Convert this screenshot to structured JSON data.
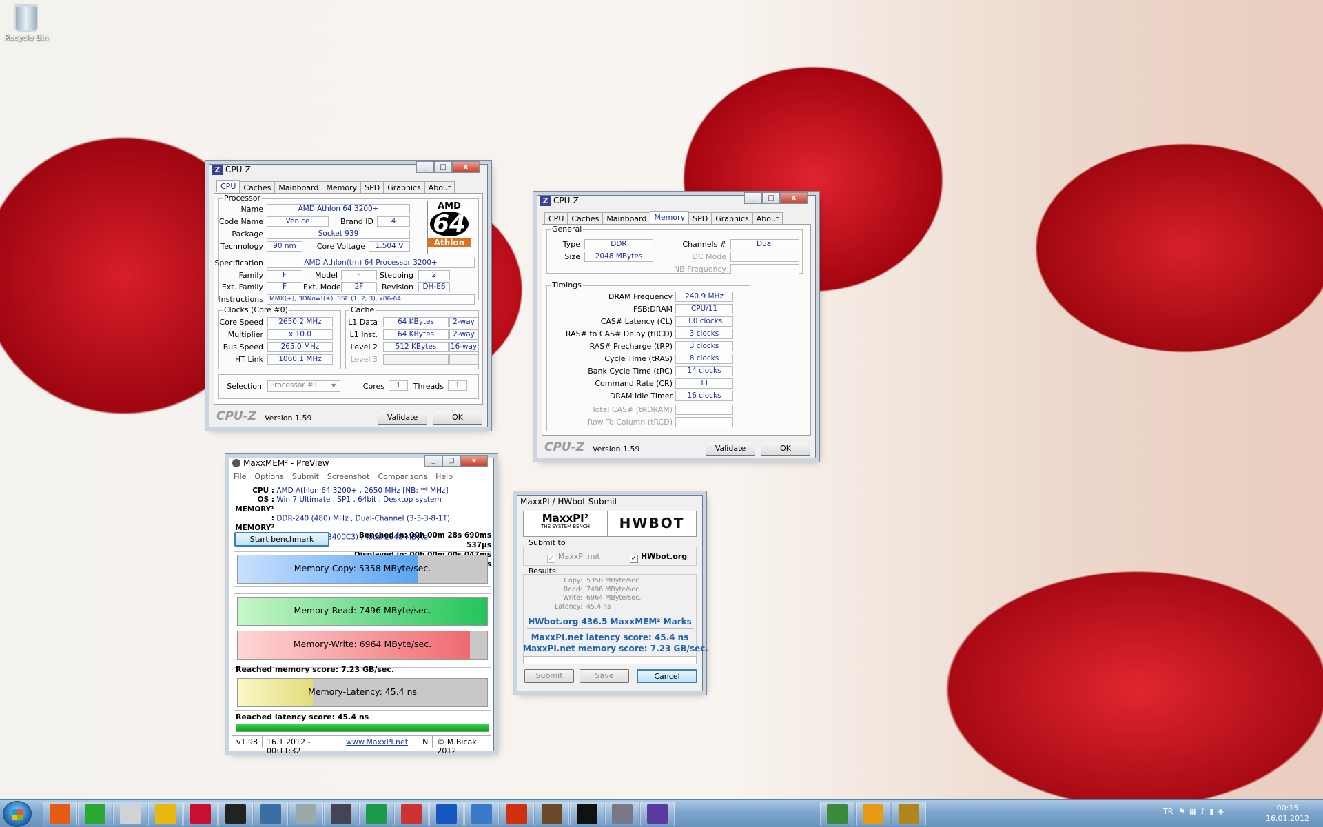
{
  "desktop": {
    "recycle_bin": "Recycle Bin"
  },
  "cpuz1": {
    "title": "CPU-Z",
    "tabs": [
      "CPU",
      "Caches",
      "Mainboard",
      "Memory",
      "SPD",
      "Graphics",
      "About"
    ],
    "processor_group": "Processor",
    "name_l": "Name",
    "name": "AMD Athlon 64 3200+",
    "codename_l": "Code Name",
    "codename": "Venice",
    "brandid_l": "Brand ID",
    "brandid": "4",
    "package_l": "Package",
    "package": "Socket 939",
    "tech_l": "Technology",
    "tech": "90 nm",
    "corev_l": "Core Voltage",
    "corev": "1.504 V",
    "spec_l": "Specification",
    "spec": "AMD Athlon(tm) 64 Processor 3200+",
    "family_l": "Family",
    "family": "F",
    "model_l": "Model",
    "model": "F",
    "stepping_l": "Stepping",
    "stepping": "2",
    "extfamily_l": "Ext. Family",
    "extfamily": "F",
    "extmodel_l": "Ext. Model",
    "extmodel": "2F",
    "revision_l": "Revision",
    "revision": "DH-E6",
    "instr_l": "Instructions",
    "instr": "MMX(+), 3DNow!(+), SSE (1, 2, 3), x86-64",
    "logo_top": "AMD",
    "logo_num": "64",
    "logo_bottom": "Athlon",
    "clocks_group": "Clocks (Core #0)",
    "corespeed_l": "Core Speed",
    "corespeed": "2650.2 MHz",
    "mult_l": "Multiplier",
    "mult": "x 10.0",
    "bus_l": "Bus Speed",
    "bus": "265.0 MHz",
    "ht_l": "HT Link",
    "ht": "1060.1 MHz",
    "cache_group": "Cache",
    "l1d_l": "L1 Data",
    "l1d": "64 KBytes",
    "l1d_w": "2-way",
    "l1i_l": "L1 Inst.",
    "l1i": "64 KBytes",
    "l1i_w": "2-way",
    "l2_l": "Level 2",
    "l2": "512 KBytes",
    "l2_w": "16-way",
    "l3_l": "Level 3",
    "selection_l": "Selection",
    "selection": "Processor #1",
    "cores_l": "Cores",
    "cores": "1",
    "threads_l": "Threads",
    "threads": "1",
    "brand": "CPU-Z",
    "version": "Version 1.59",
    "validate": "Validate",
    "ok": "OK"
  },
  "cpuz2": {
    "title": "CPU-Z",
    "tabs": [
      "CPU",
      "Caches",
      "Mainboard",
      "Memory",
      "SPD",
      "Graphics",
      "About"
    ],
    "general_group": "General",
    "type_l": "Type",
    "type": "DDR",
    "size_l": "Size",
    "size": "2048 MBytes",
    "channels_l": "Channels #",
    "channels": "Dual",
    "dcmode_l": "DC Mode",
    "nbfreq_l": "NB Frequency",
    "timings_group": "Timings",
    "timings": [
      {
        "label": "DRAM Frequency",
        "value": "240.9 MHz"
      },
      {
        "label": "FSB:DRAM",
        "value": "CPU/11"
      },
      {
        "label": "CAS# Latency (CL)",
        "value": "3.0 clocks"
      },
      {
        "label": "RAS# to CAS# Delay (tRCD)",
        "value": "3 clocks"
      },
      {
        "label": "RAS# Precharge (tRP)",
        "value": "3 clocks"
      },
      {
        "label": "Cycle Time (tRAS)",
        "value": "8 clocks"
      },
      {
        "label": "Bank Cycle Time (tRC)",
        "value": "14 clocks"
      },
      {
        "label": "Command Rate (CR)",
        "value": "1T"
      },
      {
        "label": "DRAM Idle Timer",
        "value": "16 clocks"
      }
    ],
    "totalcas_l": "Total CAS# (tRDRAM)",
    "rowcol_l": "Row To Column (tRCD)",
    "brand": "CPU-Z",
    "version": "Version 1.59",
    "validate": "Validate",
    "ok": "OK"
  },
  "maxxmem": {
    "title": "MaxxMEM² - PreView",
    "menu": [
      "File",
      "Options",
      "Submit",
      "Screenshot",
      "Comparisons",
      "Help"
    ],
    "cpu_l": "CPU :",
    "cpu": "AMD Athlon 64 3200+ , 2650 MHz  [NB: ** MHz]",
    "os_l": "OS :",
    "os": "Win 7 Ultimate , SP1 , 64bit , Desktop system",
    "mem1_l": "MEMORY¹ :",
    "mem1": "DDR-240 (480) MHz , Dual-Channel (3-3-3-8-1T)",
    "mem2_l": "MEMORY² :",
    "mem2": "Corsair (VS1GB400C3) , Total 2048 MByte",
    "start": "Start benchmark",
    "benched": "Benched in: 00h 00m 28s 690ms 537µs",
    "displayed": "Displayed in: 00h 00m 00s 047ms 345µs",
    "copy": "Memory-Copy: 5358 MByte/sec.",
    "copy_fill": 0.72,
    "read": "Memory-Read: 7496 MByte/sec.",
    "read_fill": 1.0,
    "write": "Memory-Write: 6964 MByte/sec.",
    "write_fill": 0.93,
    "mem_score": "Reached memory score: 7.23 GB/sec.",
    "latency": "Memory-Latency: 45.4 ns",
    "latency_fill": 0.3,
    "lat_score": "Reached latency score: 45.4 ns",
    "status": [
      "v1.98",
      "16.1.2012 - 00:11:32",
      "www.MaxxPI.net",
      "N",
      "© M.Bicak 2012"
    ]
  },
  "hwbot": {
    "title": "MaxxPI / HWbot Submit",
    "logo1": "MaxxPI²",
    "logo1_sub": "THE SYSTEM BENCH",
    "logo2": "HWBOT",
    "submit_to": "Submit to",
    "opt1": "MaxxPI.net",
    "opt2": "HWbot.org",
    "results_l": "Results",
    "results": [
      {
        "label": "Copy:",
        "value": "5358 MByte/sec."
      },
      {
        "label": "Read:",
        "value": "7496 MByte/sec."
      },
      {
        "label": "Write:",
        "value": "6964 MByte/sec."
      },
      {
        "label": "Latency:",
        "value": "45.4 ns"
      }
    ],
    "marks": "HWbot.org  436.5  MaxxMEM² Marks",
    "lat_score": "MaxxPI.net latency score:  45.4  ns",
    "mem_score": "MaxxPI.net memory score:  7.23  GB/sec.",
    "submit": "Submit",
    "save": "Save",
    "cancel": "Cancel"
  },
  "taskbar": {
    "lang": "TR",
    "time": "00:15",
    "date": "16.01.2012"
  }
}
